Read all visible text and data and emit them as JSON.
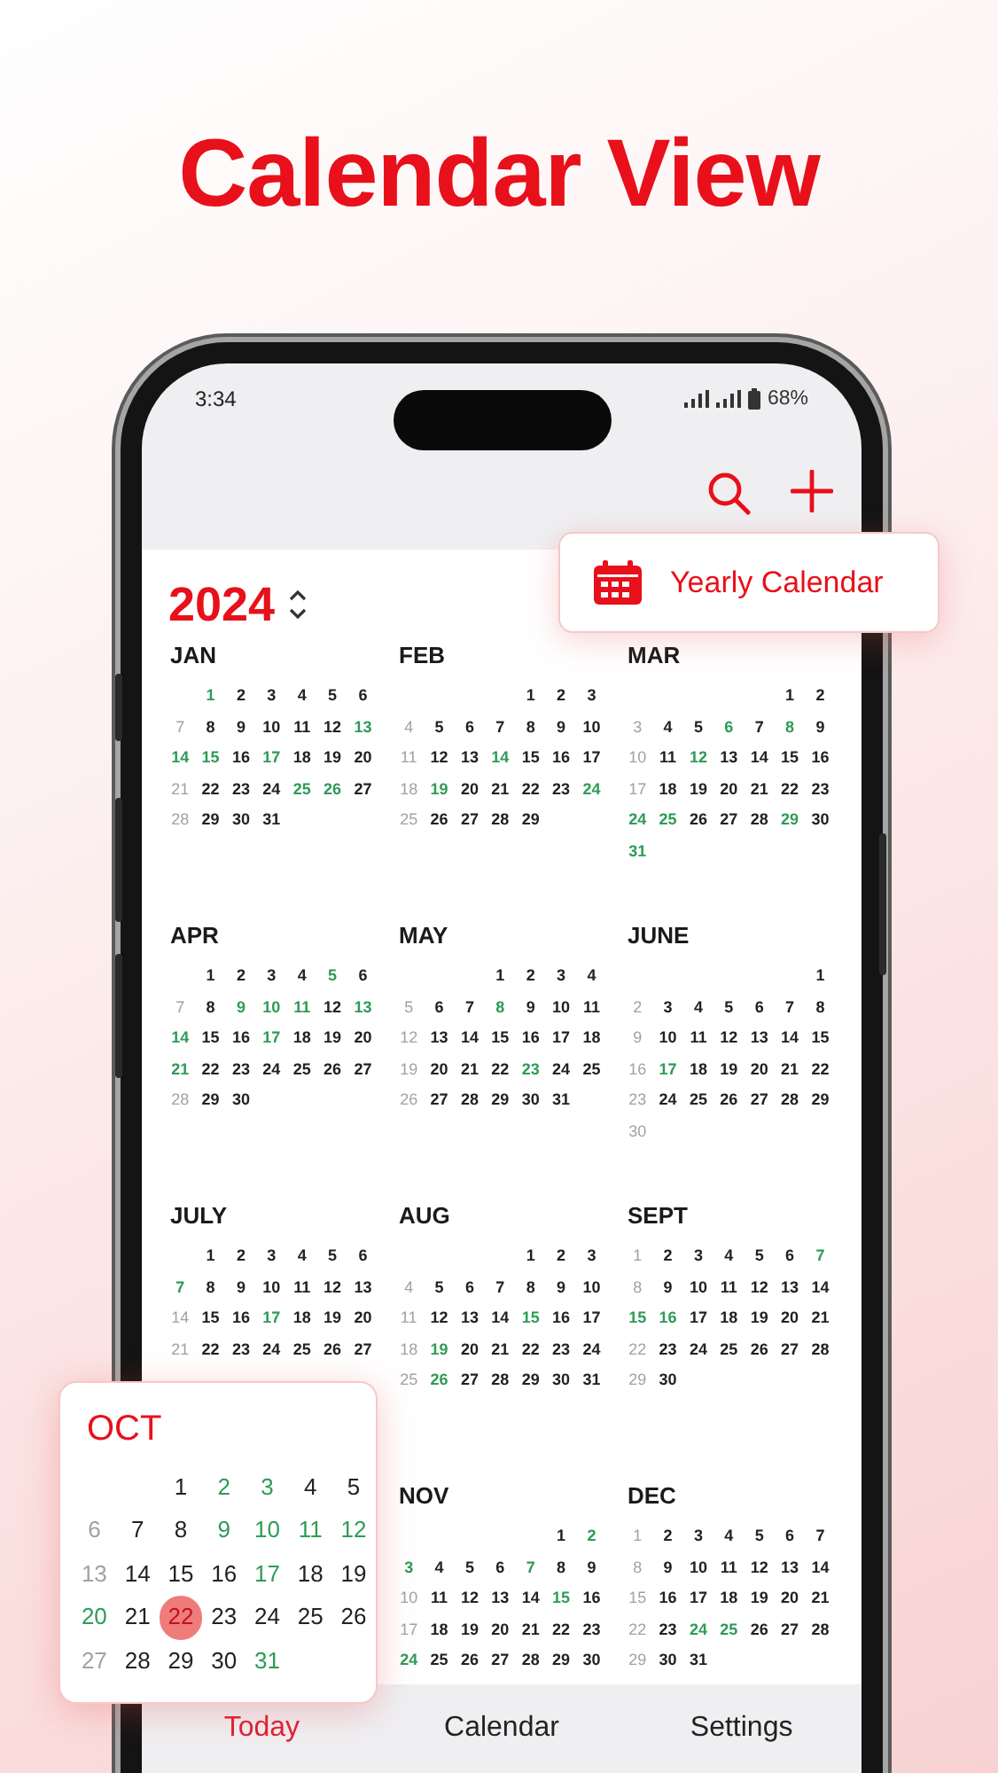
{
  "headline": "Calendar View",
  "status_bar": {
    "time": "3:34",
    "battery": "68%"
  },
  "year": "2024",
  "yearly_badge": {
    "label": "Yearly Calendar"
  },
  "month_rows": [
    [
      {
        "name": "JAN",
        "weeks": [
          [
            {
              "d": "1",
              "kind": "holiday"
            },
            {
              "d": "2",
              "kind": "plain"
            },
            {
              "d": "3",
              "kind": "plain"
            },
            {
              "d": "4",
              "kind": "plain"
            },
            {
              "d": "5",
              "kind": "plain"
            },
            {
              "d": "6",
              "kind": "plain"
            }
          ],
          [
            {
              "d": "7",
              "kind": "plain"
            },
            {
              "d": "8",
              "kind": "plain"
            },
            {
              "d": "9",
              "kind": "plain"
            },
            {
              "d": "10",
              "kind": "plain"
            },
            {
              "d": "11",
              "kind": "plain"
            },
            {
              "d": "12",
              "kind": "plain"
            },
            {
              "d": "13",
              "kind": "holiday"
            }
          ],
          [
            {
              "d": "14",
              "kind": "holiday"
            },
            {
              "d": "15",
              "kind": "holiday"
            },
            {
              "d": "16",
              "kind": "plain"
            },
            {
              "d": "17",
              "kind": "holiday"
            },
            {
              "d": "18",
              "kind": "plain"
            },
            {
              "d": "19",
              "kind": "plain"
            },
            {
              "d": "20",
              "kind": "plain"
            }
          ],
          [
            {
              "d": "21",
              "kind": "plain"
            },
            {
              "d": "22",
              "kind": "plain"
            },
            {
              "d": "23",
              "kind": "plain"
            },
            {
              "d": "24",
              "kind": "plain"
            },
            {
              "d": "25",
              "kind": "holiday"
            },
            {
              "d": "26",
              "kind": "holiday"
            },
            {
              "d": "27",
              "kind": "plain"
            }
          ],
          [
            {
              "d": "28",
              "kind": "plain"
            },
            {
              "d": "29",
              "kind": "plain"
            },
            {
              "d": "30",
              "kind": "plain"
            },
            {
              "d": "31",
              "kind": "plain"
            }
          ]
        ]
      },
      {
        "name": "FEB",
        "weeks": [
          [
            {
              "d": "1",
              "kind": "plain"
            },
            {
              "d": "2",
              "kind": "plain"
            },
            {
              "d": "3",
              "kind": "plain"
            }
          ],
          [
            {
              "d": "4",
              "kind": "plain"
            },
            {
              "d": "5",
              "kind": "plain"
            },
            {
              "d": "6",
              "kind": "plain"
            },
            {
              "d": "7",
              "kind": "plain"
            },
            {
              "d": "8",
              "kind": "plain"
            },
            {
              "d": "9",
              "kind": "plain"
            },
            {
              "d": "10",
              "kind": "plain"
            }
          ],
          [
            {
              "d": "11",
              "kind": "plain"
            },
            {
              "d": "12",
              "kind": "plain"
            },
            {
              "d": "13",
              "kind": "plain"
            },
            {
              "d": "14",
              "kind": "holiday"
            },
            {
              "d": "15",
              "kind": "plain"
            },
            {
              "d": "16",
              "kind": "plain"
            },
            {
              "d": "17",
              "kind": "plain"
            }
          ],
          [
            {
              "d": "18",
              "kind": "plain"
            },
            {
              "d": "19",
              "kind": "holiday"
            },
            {
              "d": "20",
              "kind": "plain"
            },
            {
              "d": "21",
              "kind": "plain"
            },
            {
              "d": "22",
              "kind": "plain"
            },
            {
              "d": "23",
              "kind": "plain"
            },
            {
              "d": "24",
              "kind": "holiday"
            }
          ],
          [
            {
              "d": "25",
              "kind": "plain"
            },
            {
              "d": "26",
              "kind": "plain"
            },
            {
              "d": "27",
              "kind": "plain"
            },
            {
              "d": "28",
              "kind": "plain"
            },
            {
              "d": "29",
              "kind": "plain"
            }
          ]
        ]
      },
      {
        "name": "MAR",
        "weeks": [
          [
            {
              "d": "1",
              "kind": "plain"
            },
            {
              "d": "2",
              "kind": "plain"
            }
          ],
          [
            {
              "d": "3",
              "kind": "plain"
            },
            {
              "d": "4",
              "kind": "plain"
            },
            {
              "d": "5",
              "kind": "plain"
            },
            {
              "d": "6",
              "kind": "holiday"
            },
            {
              "d": "7",
              "kind": "plain"
            },
            {
              "d": "8",
              "kind": "holiday"
            },
            {
              "d": "9",
              "kind": "plain"
            }
          ],
          [
            {
              "d": "10",
              "kind": "plain"
            },
            {
              "d": "11",
              "kind": "plain"
            },
            {
              "d": "12",
              "kind": "holiday"
            },
            {
              "d": "13",
              "kind": "plain"
            },
            {
              "d": "14",
              "kind": "plain"
            },
            {
              "d": "15",
              "kind": "plain"
            },
            {
              "d": "16",
              "kind": "plain"
            }
          ],
          [
            {
              "d": "17",
              "kind": "plain"
            },
            {
              "d": "18",
              "kind": "plain"
            },
            {
              "d": "19",
              "kind": "plain"
            },
            {
              "d": "20",
              "kind": "plain"
            },
            {
              "d": "21",
              "kind": "plain"
            },
            {
              "d": "22",
              "kind": "plain"
            },
            {
              "d": "23",
              "kind": "plain"
            }
          ],
          [
            {
              "d": "24",
              "kind": "holiday"
            },
            {
              "d": "25",
              "kind": "holiday"
            },
            {
              "d": "26",
              "kind": "plain"
            },
            {
              "d": "27",
              "kind": "plain"
            },
            {
              "d": "28",
              "kind": "plain"
            },
            {
              "d": "29",
              "kind": "holiday"
            },
            {
              "d": "30",
              "kind": "plain"
            }
          ],
          [
            {
              "d": "31",
              "kind": "holiday"
            }
          ]
        ]
      }
    ],
    [
      {
        "name": "APR",
        "weeks": [
          [
            {
              "d": "1",
              "kind": "plain"
            },
            {
              "d": "2",
              "kind": "plain"
            },
            {
              "d": "3",
              "kind": "plain"
            },
            {
              "d": "4",
              "kind": "plain"
            },
            {
              "d": "5",
              "kind": "holiday"
            },
            {
              "d": "6",
              "kind": "plain"
            }
          ],
          [
            {
              "d": "7",
              "kind": "plain"
            },
            {
              "d": "8",
              "kind": "plain"
            },
            {
              "d": "9",
              "kind": "holiday"
            },
            {
              "d": "10",
              "kind": "holiday"
            },
            {
              "d": "11",
              "kind": "holiday"
            },
            {
              "d": "12",
              "kind": "plain"
            },
            {
              "d": "13",
              "kind": "holiday"
            }
          ],
          [
            {
              "d": "14",
              "kind": "holiday"
            },
            {
              "d": "15",
              "kind": "plain"
            },
            {
              "d": "16",
              "kind": "plain"
            },
            {
              "d": "17",
              "kind": "holiday"
            },
            {
              "d": "18",
              "kind": "plain"
            },
            {
              "d": "19",
              "kind": "plain"
            },
            {
              "d": "20",
              "kind": "plain"
            }
          ],
          [
            {
              "d": "21",
              "kind": "holiday"
            },
            {
              "d": "22",
              "kind": "plain"
            },
            {
              "d": "23",
              "kind": "plain"
            },
            {
              "d": "24",
              "kind": "plain"
            },
            {
              "d": "25",
              "kind": "plain"
            },
            {
              "d": "26",
              "kind": "plain"
            },
            {
              "d": "27",
              "kind": "plain"
            }
          ],
          [
            {
              "d": "28",
              "kind": "plain"
            },
            {
              "d": "29",
              "kind": "plain"
            },
            {
              "d": "30",
              "kind": "plain"
            }
          ]
        ]
      },
      {
        "name": "MAY",
        "weeks": [
          [
            {
              "d": "1",
              "kind": "plain"
            },
            {
              "d": "2",
              "kind": "plain"
            },
            {
              "d": "3",
              "kind": "plain"
            },
            {
              "d": "4",
              "kind": "plain"
            }
          ],
          [
            {
              "d": "5",
              "kind": "plain"
            },
            {
              "d": "6",
              "kind": "plain"
            },
            {
              "d": "7",
              "kind": "plain"
            },
            {
              "d": "8",
              "kind": "holiday"
            },
            {
              "d": "9",
              "kind": "plain"
            },
            {
              "d": "10",
              "kind": "plain"
            },
            {
              "d": "11",
              "kind": "plain"
            }
          ],
          [
            {
              "d": "12",
              "kind": "plain"
            },
            {
              "d": "13",
              "kind": "plain"
            },
            {
              "d": "14",
              "kind": "plain"
            },
            {
              "d": "15",
              "kind": "plain"
            },
            {
              "d": "16",
              "kind": "plain"
            },
            {
              "d": "17",
              "kind": "plain"
            },
            {
              "d": "18",
              "kind": "plain"
            }
          ],
          [
            {
              "d": "19",
              "kind": "plain"
            },
            {
              "d": "20",
              "kind": "plain"
            },
            {
              "d": "21",
              "kind": "plain"
            },
            {
              "d": "22",
              "kind": "plain"
            },
            {
              "d": "23",
              "kind": "holiday"
            },
            {
              "d": "24",
              "kind": "plain"
            },
            {
              "d": "25",
              "kind": "plain"
            }
          ],
          [
            {
              "d": "26",
              "kind": "plain"
            },
            {
              "d": "27",
              "kind": "plain"
            },
            {
              "d": "28",
              "kind": "plain"
            },
            {
              "d": "29",
              "kind": "plain"
            },
            {
              "d": "30",
              "kind": "plain"
            },
            {
              "d": "31",
              "kind": "plain"
            }
          ]
        ]
      },
      {
        "name": "JUNE",
        "weeks": [
          [
            {
              "d": "1",
              "kind": "plain"
            }
          ],
          [
            {
              "d": "2",
              "kind": "plain"
            },
            {
              "d": "3",
              "kind": "plain"
            },
            {
              "d": "4",
              "kind": "plain"
            },
            {
              "d": "5",
              "kind": "plain"
            },
            {
              "d": "6",
              "kind": "plain"
            },
            {
              "d": "7",
              "kind": "plain"
            },
            {
              "d": "8",
              "kind": "plain"
            }
          ],
          [
            {
              "d": "9",
              "kind": "plain"
            },
            {
              "d": "10",
              "kind": "plain"
            },
            {
              "d": "11",
              "kind": "plain"
            },
            {
              "d": "12",
              "kind": "plain"
            },
            {
              "d": "13",
              "kind": "plain"
            },
            {
              "d": "14",
              "kind": "plain"
            },
            {
              "d": "15",
              "kind": "plain"
            }
          ],
          [
            {
              "d": "16",
              "kind": "plain"
            },
            {
              "d": "17",
              "kind": "holiday"
            },
            {
              "d": "18",
              "kind": "plain"
            },
            {
              "d": "19",
              "kind": "plain"
            },
            {
              "d": "20",
              "kind": "plain"
            },
            {
              "d": "21",
              "kind": "plain"
            },
            {
              "d": "22",
              "kind": "plain"
            }
          ],
          [
            {
              "d": "23",
              "kind": "plain"
            },
            {
              "d": "24",
              "kind": "plain"
            },
            {
              "d": "25",
              "kind": "plain"
            },
            {
              "d": "26",
              "kind": "plain"
            },
            {
              "d": "27",
              "kind": "plain"
            },
            {
              "d": "28",
              "kind": "plain"
            },
            {
              "d": "29",
              "kind": "plain"
            }
          ],
          [
            {
              "d": "30",
              "kind": "plain"
            }
          ]
        ]
      }
    ],
    [
      {
        "name": "JULY",
        "weeks": [
          [
            {
              "d": "1",
              "kind": "plain"
            },
            {
              "d": "2",
              "kind": "plain"
            },
            {
              "d": "3",
              "kind": "plain"
            },
            {
              "d": "4",
              "kind": "plain"
            },
            {
              "d": "5",
              "kind": "plain"
            },
            {
              "d": "6",
              "kind": "plain"
            }
          ],
          [
            {
              "d": "7",
              "kind": "holiday"
            },
            {
              "d": "8",
              "kind": "plain"
            },
            {
              "d": "9",
              "kind": "plain"
            },
            {
              "d": "10",
              "kind": "plain"
            },
            {
              "d": "11",
              "kind": "plain"
            },
            {
              "d": "12",
              "kind": "plain"
            },
            {
              "d": "13",
              "kind": "plain"
            }
          ],
          [
            {
              "d": "14",
              "kind": "plain"
            },
            {
              "d": "15",
              "kind": "plain"
            },
            {
              "d": "16",
              "kind": "plain"
            },
            {
              "d": "17",
              "kind": "holiday"
            },
            {
              "d": "18",
              "kind": "plain"
            },
            {
              "d": "19",
              "kind": "plain"
            },
            {
              "d": "20",
              "kind": "plain"
            }
          ],
          [
            {
              "d": "21",
              "kind": "plain"
            },
            {
              "d": "22",
              "kind": "plain"
            },
            {
              "d": "23",
              "kind": "plain"
            },
            {
              "d": "24",
              "kind": "plain"
            },
            {
              "d": "25",
              "kind": "plain"
            },
            {
              "d": "26",
              "kind": "plain"
            },
            {
              "d": "27",
              "kind": "plain"
            }
          ]
        ]
      },
      {
        "name": "AUG",
        "weeks": [
          [
            {
              "d": "1",
              "kind": "plain"
            },
            {
              "d": "2",
              "kind": "plain"
            },
            {
              "d": "3",
              "kind": "plain"
            }
          ],
          [
            {
              "d": "4",
              "kind": "plain"
            },
            {
              "d": "5",
              "kind": "plain"
            },
            {
              "d": "6",
              "kind": "plain"
            },
            {
              "d": "7",
              "kind": "plain"
            },
            {
              "d": "8",
              "kind": "plain"
            },
            {
              "d": "9",
              "kind": "plain"
            },
            {
              "d": "10",
              "kind": "plain"
            }
          ],
          [
            {
              "d": "11",
              "kind": "plain"
            },
            {
              "d": "12",
              "kind": "plain"
            },
            {
              "d": "13",
              "kind": "plain"
            },
            {
              "d": "14",
              "kind": "plain"
            },
            {
              "d": "15",
              "kind": "holiday"
            },
            {
              "d": "16",
              "kind": "plain"
            },
            {
              "d": "17",
              "kind": "plain"
            }
          ],
          [
            {
              "d": "18",
              "kind": "plain"
            },
            {
              "d": "19",
              "kind": "holiday"
            },
            {
              "d": "20",
              "kind": "plain"
            },
            {
              "d": "21",
              "kind": "plain"
            },
            {
              "d": "22",
              "kind": "plain"
            },
            {
              "d": "23",
              "kind": "plain"
            },
            {
              "d": "24",
              "kind": "plain"
            }
          ],
          [
            {
              "d": "25",
              "kind": "plain"
            },
            {
              "d": "26",
              "kind": "holiday"
            },
            {
              "d": "27",
              "kind": "plain"
            },
            {
              "d": "28",
              "kind": "plain"
            },
            {
              "d": "29",
              "kind": "plain"
            },
            {
              "d": "30",
              "kind": "plain"
            },
            {
              "d": "31",
              "kind": "plain"
            }
          ]
        ]
      },
      {
        "name": "SEPT",
        "weeks": [
          [
            {
              "d": "1",
              "kind": "plain"
            },
            {
              "d": "2",
              "kind": "plain"
            },
            {
              "d": "3",
              "kind": "plain"
            },
            {
              "d": "4",
              "kind": "plain"
            },
            {
              "d": "5",
              "kind": "plain"
            },
            {
              "d": "6",
              "kind": "plain"
            },
            {
              "d": "7",
              "kind": "holiday"
            }
          ],
          [
            {
              "d": "8",
              "kind": "plain"
            },
            {
              "d": "9",
              "kind": "plain"
            },
            {
              "d": "10",
              "kind": "plain"
            },
            {
              "d": "11",
              "kind": "plain"
            },
            {
              "d": "12",
              "kind": "plain"
            },
            {
              "d": "13",
              "kind": "plain"
            },
            {
              "d": "14",
              "kind": "plain"
            }
          ],
          [
            {
              "d": "15",
              "kind": "holiday"
            },
            {
              "d": "16",
              "kind": "holiday"
            },
            {
              "d": "17",
              "kind": "plain"
            },
            {
              "d": "18",
              "kind": "plain"
            },
            {
              "d": "19",
              "kind": "plain"
            },
            {
              "d": "20",
              "kind": "plain"
            },
            {
              "d": "21",
              "kind": "plain"
            }
          ],
          [
            {
              "d": "22",
              "kind": "plain"
            },
            {
              "d": "23",
              "kind": "plain"
            },
            {
              "d": "24",
              "kind": "plain"
            },
            {
              "d": "25",
              "kind": "plain"
            },
            {
              "d": "26",
              "kind": "plain"
            },
            {
              "d": "27",
              "kind": "plain"
            },
            {
              "d": "28",
              "kind": "plain"
            }
          ],
          [
            {
              "d": "29",
              "kind": "plain"
            },
            {
              "d": "30",
              "kind": "plain"
            }
          ]
        ]
      }
    ],
    [
      {
        "name": "NOV",
        "weeks": [
          [
            {
              "d": "1",
              "kind": "plain"
            },
            {
              "d": "2",
              "kind": "holiday"
            }
          ],
          [
            {
              "d": "3",
              "kind": "holiday"
            },
            {
              "d": "4",
              "kind": "plain"
            },
            {
              "d": "5",
              "kind": "plain"
            },
            {
              "d": "6",
              "kind": "plain"
            },
            {
              "d": "7",
              "kind": "holiday"
            },
            {
              "d": "8",
              "kind": "plain"
            },
            {
              "d": "9",
              "kind": "plain"
            }
          ],
          [
            {
              "d": "10",
              "kind": "plain"
            },
            {
              "d": "11",
              "kind": "plain"
            },
            {
              "d": "12",
              "kind": "plain"
            },
            {
              "d": "13",
              "kind": "plain"
            },
            {
              "d": "14",
              "kind": "plain"
            },
            {
              "d": "15",
              "kind": "holiday"
            },
            {
              "d": "16",
              "kind": "plain"
            }
          ],
          [
            {
              "d": "17",
              "kind": "plain"
            },
            {
              "d": "18",
              "kind": "plain"
            },
            {
              "d": "19",
              "kind": "plain"
            },
            {
              "d": "20",
              "kind": "plain"
            },
            {
              "d": "21",
              "kind": "plain"
            },
            {
              "d": "22",
              "kind": "plain"
            },
            {
              "d": "23",
              "kind": "plain"
            }
          ],
          [
            {
              "d": "24",
              "kind": "holiday"
            },
            {
              "d": "25",
              "kind": "plain"
            },
            {
              "d": "26",
              "kind": "plain"
            },
            {
              "d": "27",
              "kind": "plain"
            },
            {
              "d": "28",
              "kind": "plain"
            },
            {
              "d": "29",
              "kind": "plain"
            },
            {
              "d": "30",
              "kind": "plain"
            }
          ]
        ]
      },
      {
        "name": "DEC",
        "weeks": [
          [
            {
              "d": "1",
              "kind": "plain"
            },
            {
              "d": "2",
              "kind": "plain"
            },
            {
              "d": "3",
              "kind": "plain"
            },
            {
              "d": "4",
              "kind": "plain"
            },
            {
              "d": "5",
              "kind": "plain"
            },
            {
              "d": "6",
              "kind": "plain"
            },
            {
              "d": "7",
              "kind": "plain"
            }
          ],
          [
            {
              "d": "8",
              "kind": "plain"
            },
            {
              "d": "9",
              "kind": "plain"
            },
            {
              "d": "10",
              "kind": "plain"
            },
            {
              "d": "11",
              "kind": "plain"
            },
            {
              "d": "12",
              "kind": "plain"
            },
            {
              "d": "13",
              "kind": "plain"
            },
            {
              "d": "14",
              "kind": "plain"
            }
          ],
          [
            {
              "d": "15",
              "kind": "plain"
            },
            {
              "d": "16",
              "kind": "plain"
            },
            {
              "d": "17",
              "kind": "plain"
            },
            {
              "d": "18",
              "kind": "plain"
            },
            {
              "d": "19",
              "kind": "plain"
            },
            {
              "d": "20",
              "kind": "plain"
            },
            {
              "d": "21",
              "kind": "plain"
            }
          ],
          [
            {
              "d": "22",
              "kind": "plain"
            },
            {
              "d": "23",
              "kind": "plain"
            },
            {
              "d": "24",
              "kind": "holiday"
            },
            {
              "d": "25",
              "kind": "holiday"
            },
            {
              "d": "26",
              "kind": "plain"
            },
            {
              "d": "27",
              "kind": "plain"
            },
            {
              "d": "28",
              "kind": "plain"
            }
          ],
          [
            {
              "d": "29",
              "kind": "plain"
            },
            {
              "d": "30",
              "kind": "plain"
            },
            {
              "d": "31",
              "kind": "plain"
            }
          ]
        ]
      }
    ]
  ],
  "month_popup": {
    "name": "OCT",
    "weeks": [
      [
        {
          "d": "1",
          "kind": "plain"
        },
        {
          "d": "2",
          "kind": "holiday"
        },
        {
          "d": "3",
          "kind": "holiday"
        },
        {
          "d": "4",
          "kind": "plain"
        },
        {
          "d": "5",
          "kind": "plain"
        }
      ],
      [
        {
          "d": "6",
          "kind": "plain"
        },
        {
          "d": "7",
          "kind": "plain"
        },
        {
          "d": "8",
          "kind": "plain"
        },
        {
          "d": "9",
          "kind": "holiday"
        },
        {
          "d": "10",
          "kind": "holiday"
        },
        {
          "d": "11",
          "kind": "holiday"
        },
        {
          "d": "12",
          "kind": "holiday"
        }
      ],
      [
        {
          "d": "13",
          "kind": "plain"
        },
        {
          "d": "14",
          "kind": "plain"
        },
        {
          "d": "15",
          "kind": "plain"
        },
        {
          "d": "16",
          "kind": "plain"
        },
        {
          "d": "17",
          "kind": "holiday"
        },
        {
          "d": "18",
          "kind": "plain"
        },
        {
          "d": "19",
          "kind": "plain"
        }
      ],
      [
        {
          "d": "20",
          "kind": "holiday"
        },
        {
          "d": "21",
          "kind": "plain"
        },
        {
          "d": "22",
          "kind": "today"
        },
        {
          "d": "23",
          "kind": "plain"
        },
        {
          "d": "24",
          "kind": "plain"
        },
        {
          "d": "25",
          "kind": "plain"
        },
        {
          "d": "26",
          "kind": "plain"
        }
      ],
      [
        {
          "d": "27",
          "kind": "plain"
        },
        {
          "d": "28",
          "kind": "plain"
        },
        {
          "d": "29",
          "kind": "plain"
        },
        {
          "d": "30",
          "kind": "plain"
        },
        {
          "d": "31",
          "kind": "holiday"
        }
      ]
    ]
  },
  "tabs": [
    {
      "label": "Today",
      "selected": true
    },
    {
      "label": "Calendar",
      "selected": false
    },
    {
      "label": "Settings",
      "selected": false
    }
  ]
}
